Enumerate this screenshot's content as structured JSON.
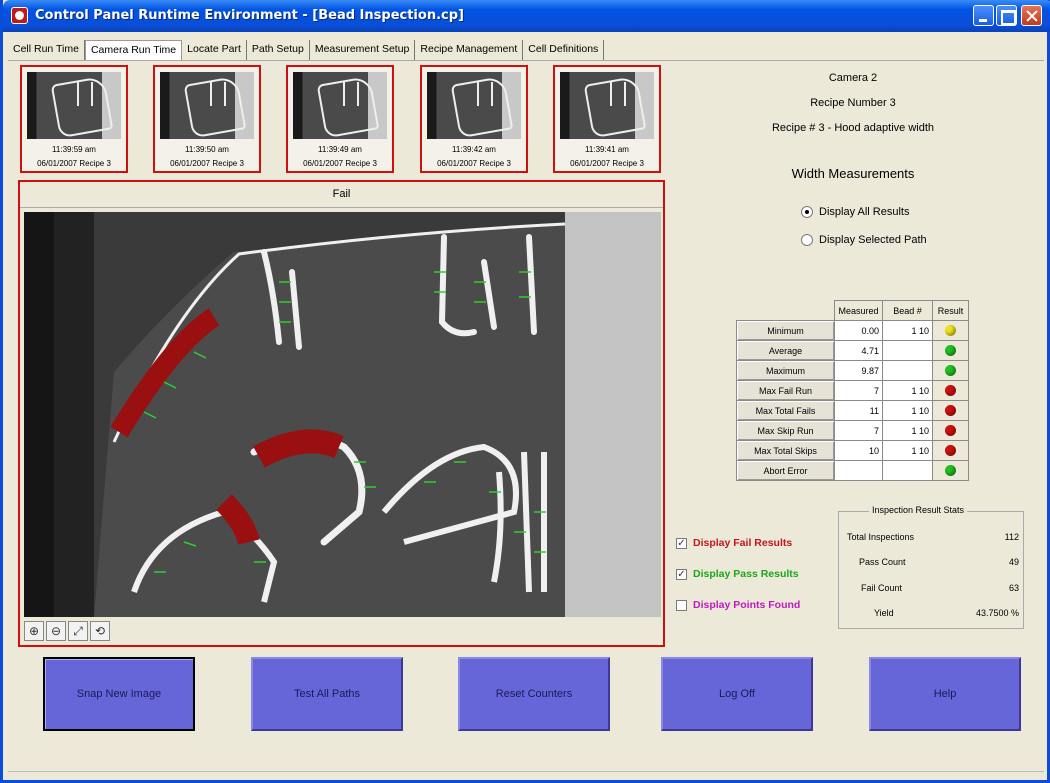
{
  "window": {
    "title": "Control Panel Runtime Environment - [Bead Inspection.cp]"
  },
  "tabs": [
    {
      "label": "Cell Run Time"
    },
    {
      "label": "Camera Run Time"
    },
    {
      "label": "Locate Part"
    },
    {
      "label": "Path Setup"
    },
    {
      "label": "Measurement Setup"
    },
    {
      "label": "Recipe Management"
    },
    {
      "label": "Cell Definitions"
    }
  ],
  "thumbnails": [
    {
      "time": "11:39:59 am",
      "caption": "06/01/2007 Recipe 3"
    },
    {
      "time": "11:39:50 am",
      "caption": "06/01/2007 Recipe 3"
    },
    {
      "time": "11:39:49 am",
      "caption": "06/01/2007 Recipe 3"
    },
    {
      "time": "11:39:42 am",
      "caption": "06/01/2007 Recipe 3"
    },
    {
      "time": "11:39:41 am",
      "caption": "06/01/2007 Recipe 3"
    }
  ],
  "viewer": {
    "status": "Fail"
  },
  "info": {
    "camera": "Camera 2",
    "recipe_number": "Recipe Number   3",
    "recipe_name": "Recipe # 3 - Hood adaptive width",
    "section_title": "Width Measurements",
    "radio_all": "Display All Results",
    "radio_selected": "Display Selected Path"
  },
  "table": {
    "headers": [
      "Measured",
      "Bead #",
      "Result"
    ],
    "rows": [
      {
        "label": "Minimum",
        "measured": "0.00",
        "bead": "1 10",
        "status": "yellow"
      },
      {
        "label": "Average",
        "measured": "4.71",
        "bead": "",
        "status": "green"
      },
      {
        "label": "Maximum",
        "measured": "9.87",
        "bead": "",
        "status": "green"
      },
      {
        "label": "Max Fail Run",
        "measured": "7",
        "bead": "1 10",
        "status": "red"
      },
      {
        "label": "Max Total Fails",
        "measured": "11",
        "bead": "1 10",
        "status": "red"
      },
      {
        "label": "Max Skip Run",
        "measured": "7",
        "bead": "1 10",
        "status": "red"
      },
      {
        "label": "Max Total Skips",
        "measured": "10",
        "bead": "1 10",
        "status": "red"
      },
      {
        "label": "Abort Error",
        "measured": "",
        "bead": "",
        "status": "green"
      }
    ]
  },
  "checkboxes": {
    "fail": {
      "label": "Display Fail Results",
      "color": "#c01818"
    },
    "pass": {
      "label": "Display Pass Results",
      "color": "#1aa81a"
    },
    "points": {
      "label": "Display Points Found",
      "color": "#c018c0"
    }
  },
  "stats": {
    "title": "Inspection Result Stats",
    "total_label": "Total Inspections",
    "total": "112",
    "pass_label": "Pass Count",
    "pass": "49",
    "fail_label": "Fail Count",
    "fail": "63",
    "yield_label": "Yield",
    "yield": "43.7500 %"
  },
  "buttons": {
    "snap": "Snap New Image",
    "test": "Test All Paths",
    "reset": "Reset Counters",
    "logoff": "Log Off",
    "help": "Help"
  },
  "colors": {
    "yellow": "#f0e020",
    "green": "#22c022",
    "red": "#d01010",
    "button": "#6666d8",
    "frame": "#d01010"
  }
}
